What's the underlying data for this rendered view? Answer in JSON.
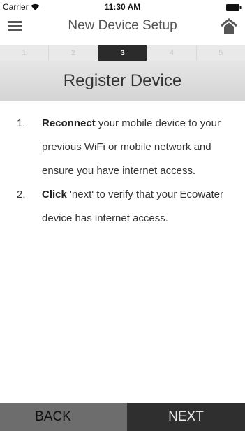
{
  "status_bar": {
    "carrier": "Carrier",
    "time": "11:30 AM",
    "icons": [
      "wifi-icon",
      "battery-icon"
    ]
  },
  "nav": {
    "title": "New Device Setup",
    "menu_icon": "hamburger-menu-icon",
    "home_icon": "home-icon"
  },
  "steps": {
    "items": [
      "1",
      "2",
      "3",
      "4",
      "5"
    ],
    "active": "3"
  },
  "section": {
    "title": "Register Device"
  },
  "instructions": [
    {
      "number": "1.",
      "bold": "Reconnect",
      "text": " your mobile device to your previous WiFi or mobile network and ensure you have internet access."
    },
    {
      "number": "2.",
      "bold": "Click",
      "text": " 'next' to verify that your Ecowater device has internet access."
    }
  ],
  "footer": {
    "back_label": "BACK",
    "next_label": "NEXT"
  },
  "colors": {
    "active_step": "#2b2b2b",
    "back_button": "#6d6d6d",
    "next_button": "#2f2f2f",
    "header_bg": "#dcdcdc"
  }
}
